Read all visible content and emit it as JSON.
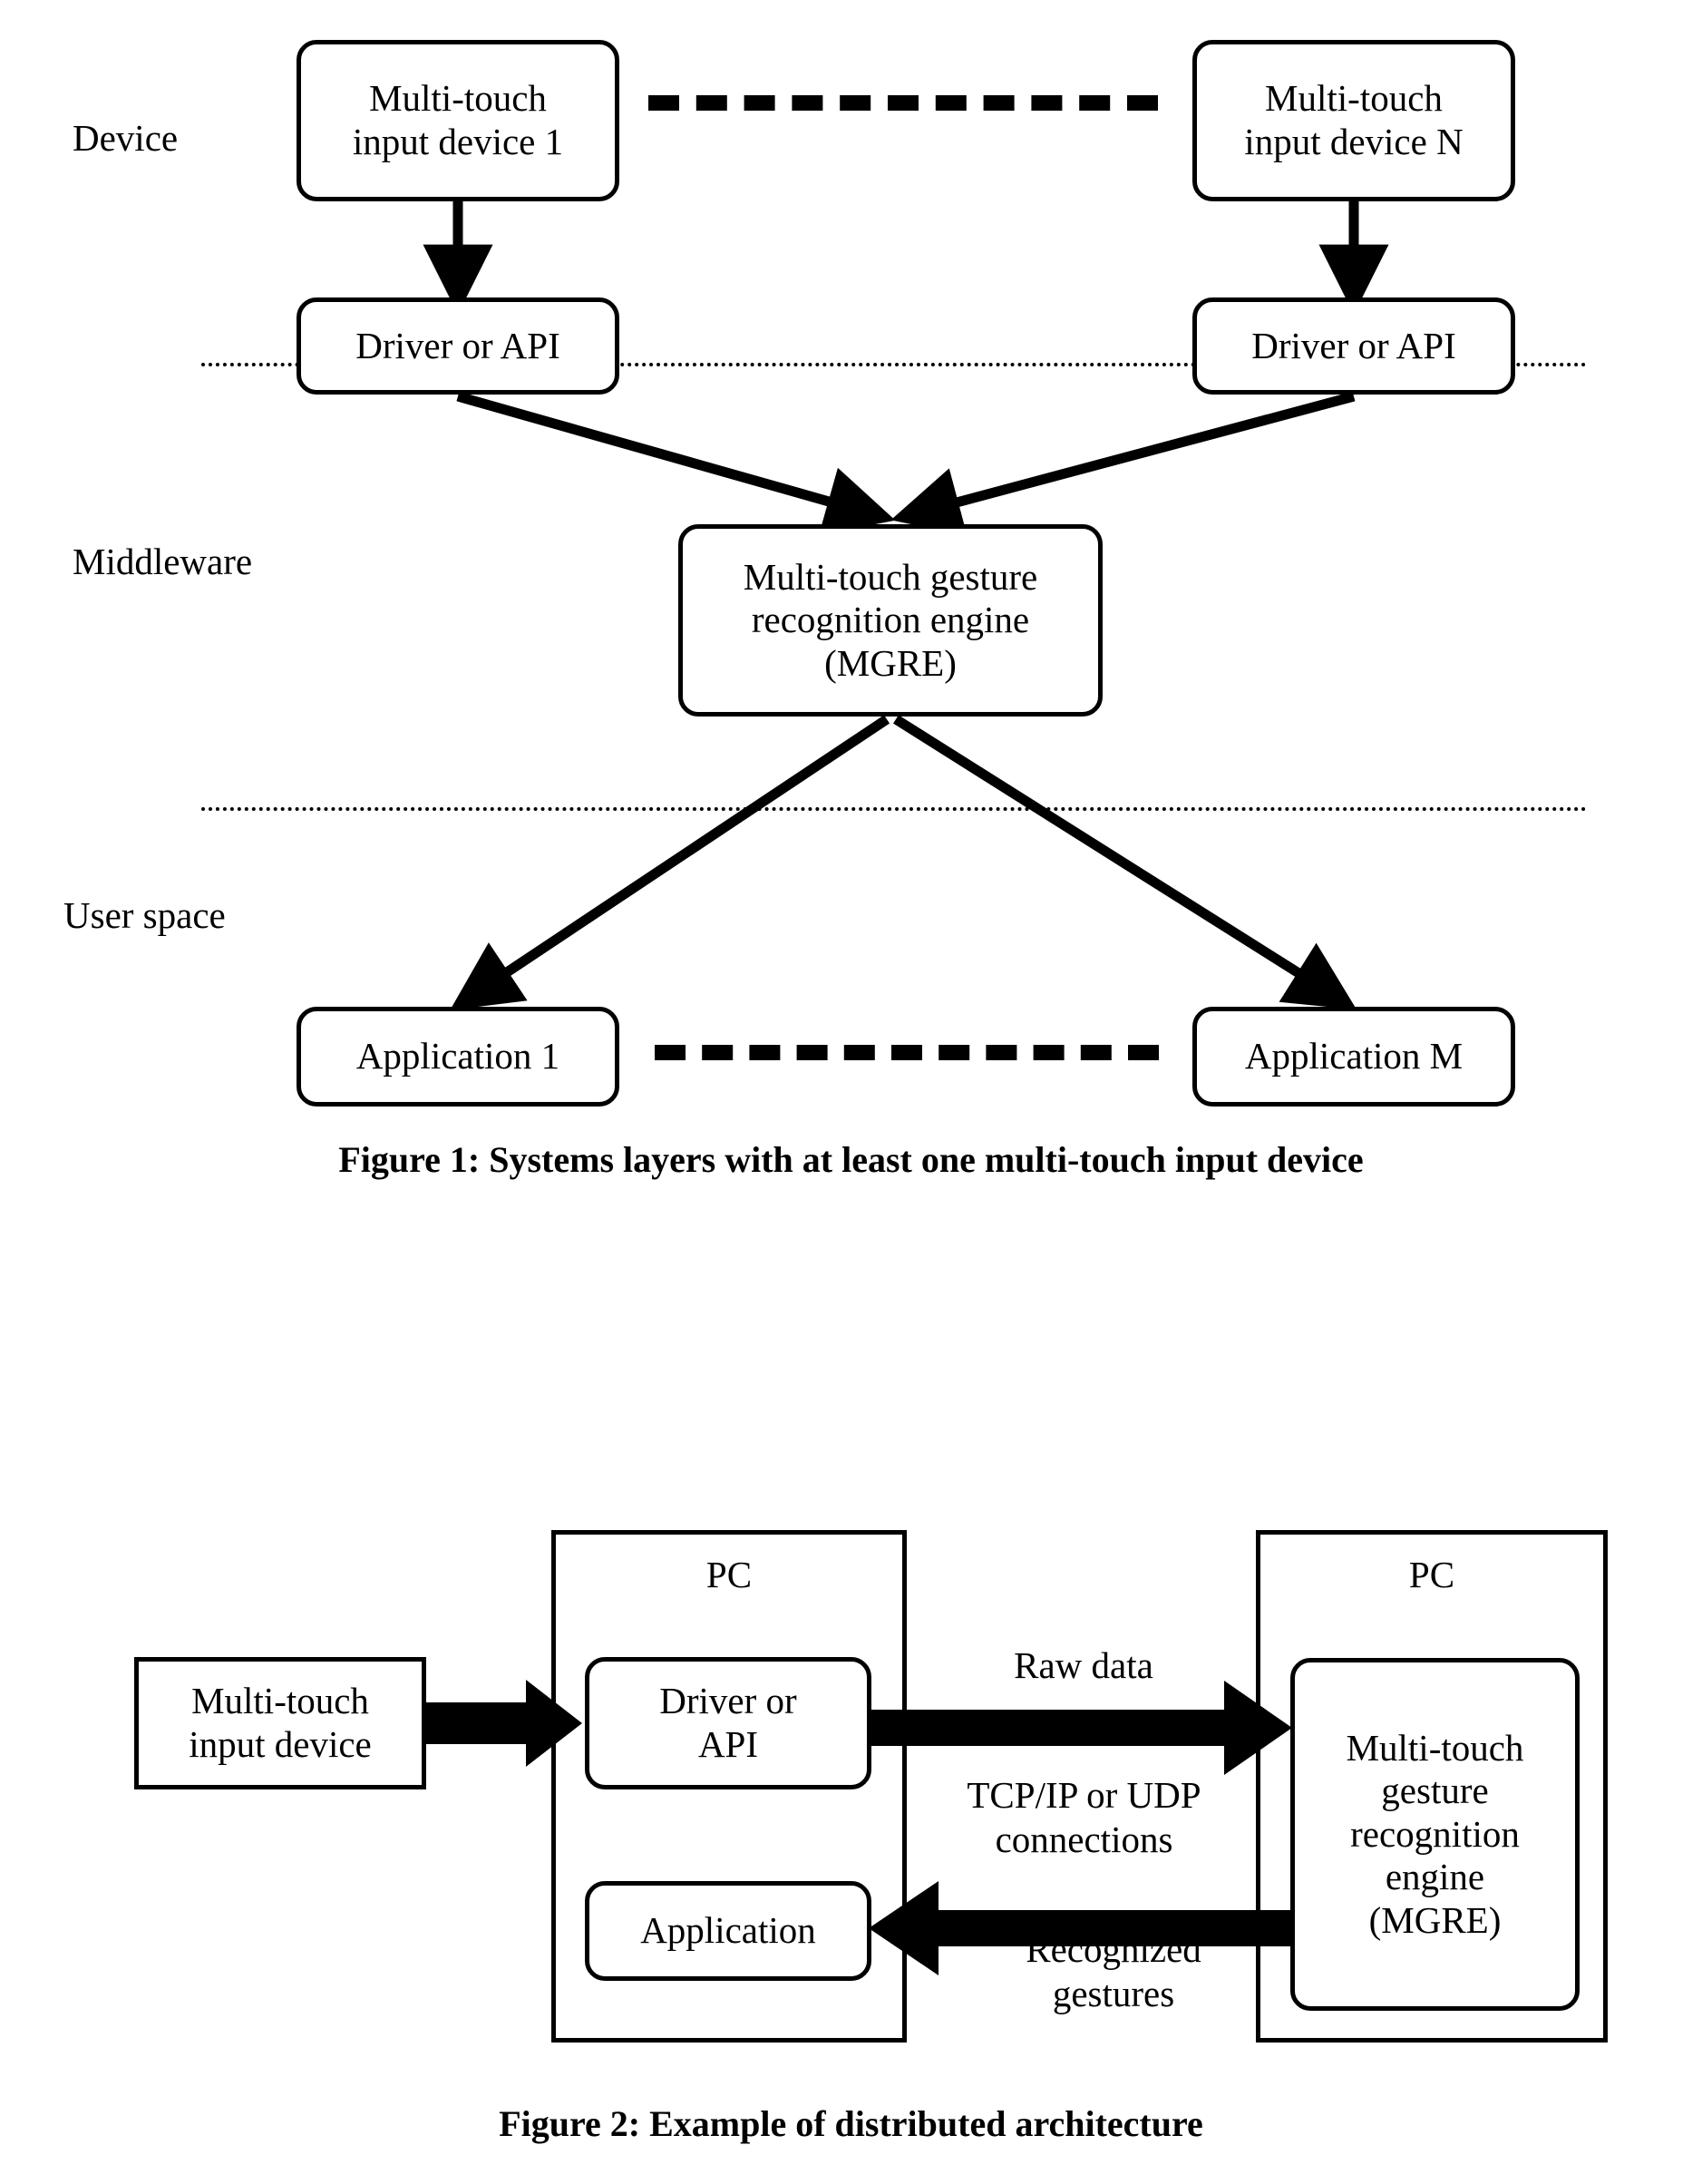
{
  "figure1": {
    "caption": "Figure 1: Systems layers with at least one multi-touch input device",
    "layers": [
      {
        "label": "Device"
      },
      {
        "label": "Middleware"
      },
      {
        "label": "User space"
      }
    ],
    "nodes": {
      "device_1": "Multi-touch\ninput device 1",
      "device_n": "Multi-touch\ninput device N",
      "driver_left": "Driver or API",
      "driver_right": "Driver or API",
      "mgre": "Multi-touch gesture\nrecognition engine\n(MGRE)",
      "app_1": "Application 1",
      "app_m": "Application M"
    }
  },
  "figure2": {
    "caption": "Figure 2: Example of distributed architecture",
    "containers": {
      "pc_left": "PC",
      "pc_right": "PC"
    },
    "nodes": {
      "input_device": "Multi-touch\ninput device",
      "driver": "Driver or\nAPI",
      "application": "Application",
      "mgre": "Multi-touch\ngesture\nrecognition\nengine\n(MGRE)"
    },
    "edge_labels": {
      "raw_data": "Raw data",
      "protocol": "TCP/IP or UDP\nconnections",
      "recognized": "Recognized\ngestures"
    }
  },
  "colors": {
    "ink": "#000000",
    "paper": "#ffffff"
  }
}
